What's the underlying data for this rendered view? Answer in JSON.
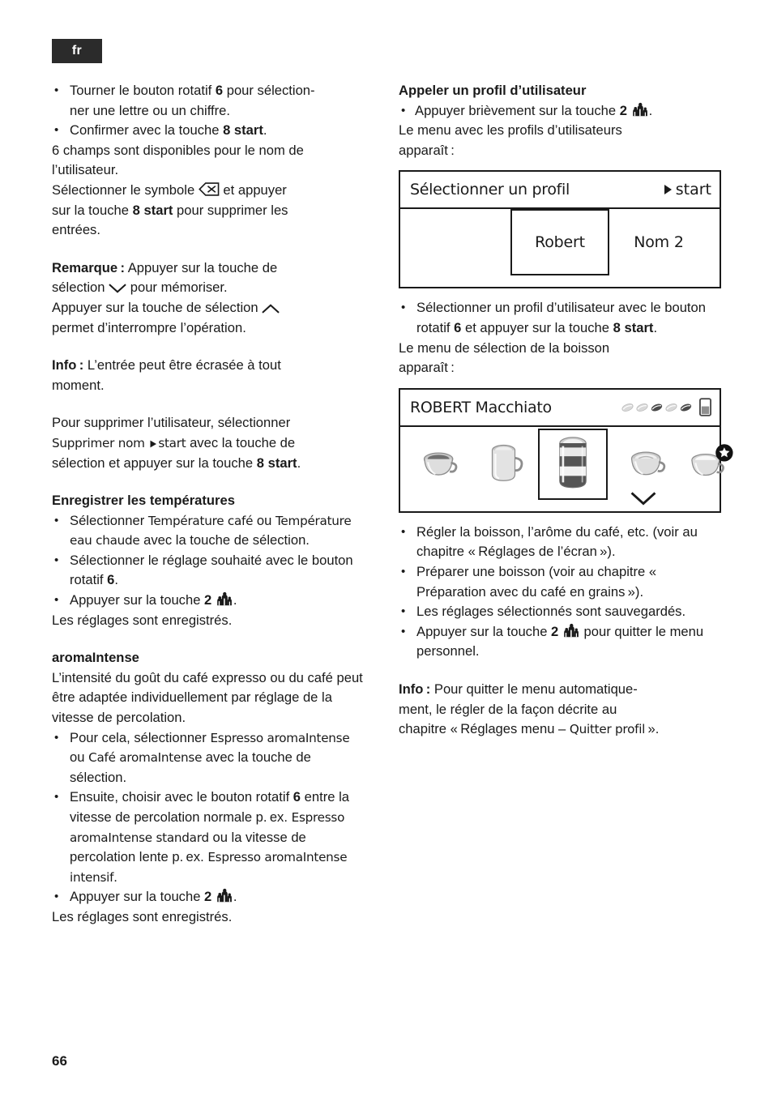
{
  "page": {
    "language_tab": "fr",
    "page_number": "66"
  },
  "left_column": {
    "bullets_top": [
      "Tourner le bouton rotatif <b>6</b> pour sélection-<br>ner une lettre ou un chiffre.",
      "Confirmer avec la touche <b>8 start</b>."
    ],
    "para_fields": "6 champs sont disponibles pour le nom de<br>l’utilisateur.",
    "para_delete": "Sélectionner le symbole ⌫ et appuyer<br>sur la touche <b>8 start</b> pour supprimer les<br>entrées.",
    "remark_label": "Remarque :",
    "remark_text_1": "Appuyer sur la touche de<br>sélection ∨ pour mémoriser.",
    "remark_text_2": "Appuyer sur la touche de sélection ∧<br>permet d’interrompre l’opération.",
    "info_label": "Info :",
    "info_text": "L’entrée peut être écrasée à tout<br>moment.",
    "delete_user_1": "Pour supprimer l’utilisateur, sélectionner",
    "delete_user_ui": "Supprimer nom",
    "delete_user_start": "start",
    "delete_user_2": "avec la touche de<br>sélection et appuyer sur la touche <b>8 start</b>.",
    "temp_heading": "Enregistrer les températures",
    "temp_bullet_1_a": "Sélectionner",
    "temp_bullet_1_ui_1": "Température café",
    "temp_bullet_1_b": "ou",
    "temp_bullet_1_ui_2": "Température eau chaude",
    "temp_bullet_1_c": "avec la touche de sélection.",
    "temp_bullet_2": "Sélectionner le réglage souhaité avec le bouton rotatif <b>6</b>.",
    "temp_bullet_3": "Appuyer sur la touche <b>2</b>",
    "temp_saved": "Les réglages sont enregistrés.",
    "aroma_heading": "aromaIntense",
    "aroma_para": "L’intensité du goût du café expresso ou du café peut être adaptée individuellement par réglage de la vitesse de percolation.",
    "aroma_b1_a": "Pour cela, sélectionner",
    "aroma_b1_ui_1": "Espresso aromaIntense",
    "aroma_b1_b": "ou",
    "aroma_b1_ui_2": "Café aromaIntense",
    "aroma_b1_c": "avec la touche de sélection.",
    "aroma_b2_a": "Ensuite, choisir avec le bouton rotatif <b>6</b> entre la vitesse de percolation normale p. ex.",
    "aroma_b2_ui_1": "Espresso aromaIntense standard",
    "aroma_b2_b": "ou la vitesse de percolation lente p. ex.",
    "aroma_b2_ui_2": "Espresso aromaIntense intensif",
    "aroma_b3": "Appuyer sur la touche <b>2</b>",
    "aroma_saved": "Les réglages sont enregistrés."
  },
  "right_column": {
    "heading": "Appeler un profil d’utilisateur",
    "bullet_1": "Appuyer brièvement sur la touche <b>2</b>",
    "para_menu": "Le menu avec les profils d’utilisateurs<br>apparaît :",
    "display_profile": {
      "title": "Sélectionner un profil",
      "start_label": "start",
      "start_icon": "play-triangle-icon",
      "selected_profile": "Robert",
      "other_profile": "Nom 2"
    },
    "bullet_2": "Sélectionner un profil d’utilisateur avec le bouton rotatif <b>6</b> et appuyer sur la touche <b>8 start</b>.",
    "para_drink_menu": "Le menu de sélection de la boisson<br>apparaît :",
    "display_drinks": {
      "title": "ROBERT Macchiato",
      "bean_count": 5,
      "bean_filled_index": 2,
      "cup_level_icon": "cup-level-icon",
      "drinks": [
        {
          "name": "espresso-cup-icon",
          "selected": false
        },
        {
          "name": "coffee-mug-icon",
          "selected": false
        },
        {
          "name": "latte-macchiato-glass-icon",
          "selected": true
        },
        {
          "name": "cappuccino-cup-icon",
          "selected": false
        },
        {
          "name": "favourite-drink-cup-icon",
          "selected": false
        }
      ],
      "scroll_hint_icon": "chevron-down-icon"
    },
    "bullets_after": [
      "Régler la boisson, l’arôme du café, etc. (voir au chapitre « Réglages de l’écran »).",
      "Préparer une boisson (voir au chapitre « Préparation avec du café en grains »).",
      "Les réglages sélectionnés sont sauvegardés."
    ],
    "bullet_exit": "Appuyer sur la touche <b>2</b>",
    "bullet_exit_tail": "pour quitter le menu personnel.",
    "info_label": "Info :",
    "info_text_1": "Pour quitter le menu automatique-<br>ment, le régler de la façon décrite au<br>chapitre « Réglages menu –",
    "info_text_ui": "Quitter profil",
    "info_text_2": " »."
  },
  "icons": {
    "personalization": "personalization-icon",
    "backspace": "backspace-icon",
    "chevron_down": "chevron-down-icon",
    "chevron_up": "chevron-up-icon"
  },
  "colors": {
    "text": "#1a1a1a",
    "tab_bg": "#2b2b2b",
    "tab_text": "#ffffff",
    "page_bg": "#ffffff"
  }
}
